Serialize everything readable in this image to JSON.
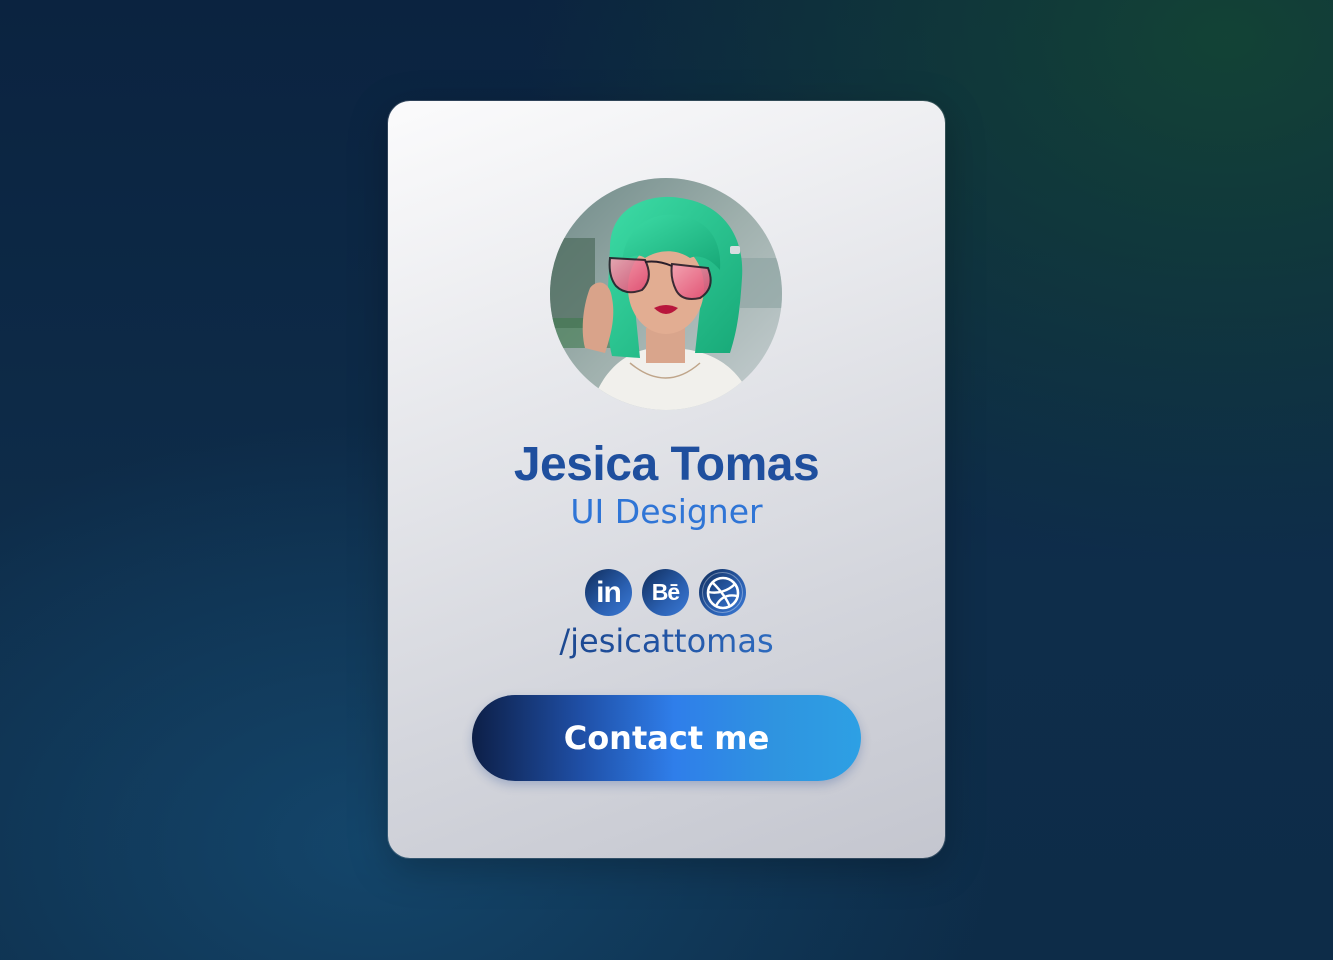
{
  "profile": {
    "name": "Jesica Tomas",
    "role": "UI Designer",
    "handle": "/jesicattomas"
  },
  "socials": [
    {
      "network": "LinkedIn",
      "label": "in",
      "icon": "linkedin-icon"
    },
    {
      "network": "Behance",
      "label": "Bē",
      "icon": "behance-icon"
    },
    {
      "network": "Dribbble",
      "label": "",
      "icon": "dribbble-icon"
    }
  ],
  "actions": {
    "contact_label": "Contact me"
  },
  "colors": {
    "name": "#1f4f9e",
    "role": "#2f75d6",
    "button_start": "#0d1f47",
    "button_mid": "#2f7eea",
    "button_end": "#2da0e4",
    "hair": "#2bc694"
  }
}
